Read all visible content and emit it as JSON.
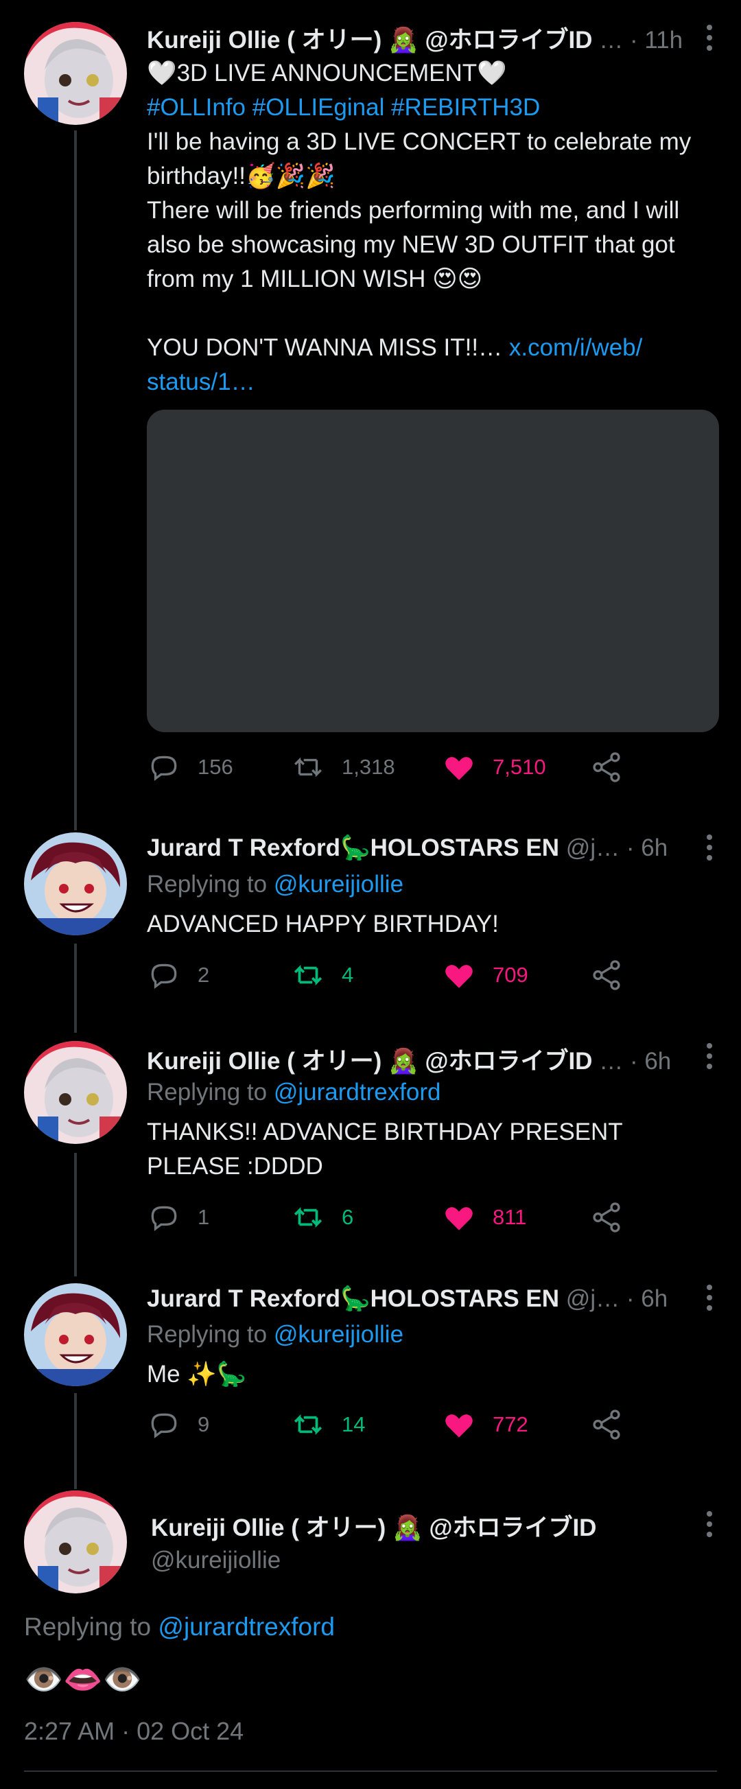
{
  "tweets": [
    {
      "name": "Kureiji Ollie ( オリー)",
      "badge_emoji": "🧟‍♀️",
      "handle": "@ホロライブID",
      "ellipsis": "…",
      "time": "· 11h",
      "lines": [
        "🤍3D LIVE ANNOUNCEMENT🤍",
        "#OLLInfo #OLLIEginal #REBIRTH3D",
        "I'll be having a 3D LIVE CONCERT to celebrate my",
        "birthday!!🥳🎉🎉",
        "There will be friends performing with me, and I will",
        "also be showcasing my NEW 3D OUTFIT that got",
        "from my 1 MILLION WISH 😍😍",
        "",
        "YOU DON'T WANNA MISS IT!!…",
        "x.com/i/web/",
        "status/1…"
      ],
      "replies": "156",
      "retweets": "1,318",
      "likes": "7,510"
    },
    {
      "name": "Jurard T Rexford🦕HOLOSTARS EN",
      "handle": "@j…",
      "time": "· 6h",
      "replying_prefix": "Replying to",
      "replying_to": "@kureijiollie",
      "text": "ADVANCED HAPPY BIRTHDAY!",
      "replies": "2",
      "retweets": "4",
      "likes": "709"
    },
    {
      "name": "Kureiji Ollie ( オリー)",
      "badge_emoji": "🧟‍♀️",
      "handle": "@ホロライブID",
      "ellipsis": "…",
      "time": "· 6h",
      "replying_prefix": "Replying to",
      "replying_to": "@jurardtrexford",
      "lines": [
        "THANKS!! ADVANCE BIRTHDAY PRESENT",
        "PLEASE :DDDD"
      ],
      "replies": "1",
      "retweets": "6",
      "likes": "811"
    },
    {
      "name": "Jurard T Rexford🦕HOLOSTARS EN",
      "handle": "@j…",
      "time": "· 6h",
      "replying_prefix": "Replying to",
      "replying_to": "@kureijiollie",
      "text": "Me ✨🦕",
      "replies": "9",
      "retweets": "14",
      "likes": "772"
    }
  ],
  "focused": {
    "name": "Kureiji Ollie ( オリー)",
    "badge_emoji": "🧟‍♀️",
    "handle_display": "@ホロライブID",
    "username": "@kureijiollie",
    "replying_prefix": "Replying to",
    "replying_to": "@jurardtrexford",
    "text": "👁️👄👁️",
    "timestamp": "2:27 AM · 02 Oct 24"
  },
  "colors": {
    "background": "#000000",
    "link": "#1d9bf0",
    "retweet_active": "#00ba7c",
    "like_active": "#f91880",
    "secondary_text": "#71767b"
  }
}
